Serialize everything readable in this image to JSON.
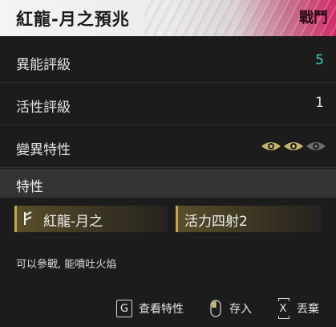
{
  "header": {
    "title": "紅龍-月之預兆",
    "tag": "戰鬥"
  },
  "rows": [
    {
      "label": "異能評級",
      "value": "5"
    },
    {
      "label": "活性評級",
      "value": "1"
    },
    {
      "label": "變異特性",
      "value": ""
    }
  ],
  "mutation_eyes": {
    "filled": 2,
    "total": 3,
    "active_color": "#c9b56a",
    "inactive_color": "#6d6d6d"
  },
  "traits_section": {
    "title": "特性"
  },
  "traits": [
    {
      "label": "紅龍-月之",
      "icon": "rune-icon"
    },
    {
      "label": "活力四射2"
    }
  ],
  "description": "可以參戰, 能噴吐火焰",
  "footer": {
    "view_traits": {
      "key": "G",
      "label": "查看特性"
    },
    "store": {
      "key": "mouse",
      "label": "存入"
    },
    "discard": {
      "key": "X",
      "label": "丟棄"
    }
  },
  "colors": {
    "accent_teal": "#3fd3be",
    "header_pink": "#d42d6a",
    "trait_gold": "#c6a64a"
  }
}
